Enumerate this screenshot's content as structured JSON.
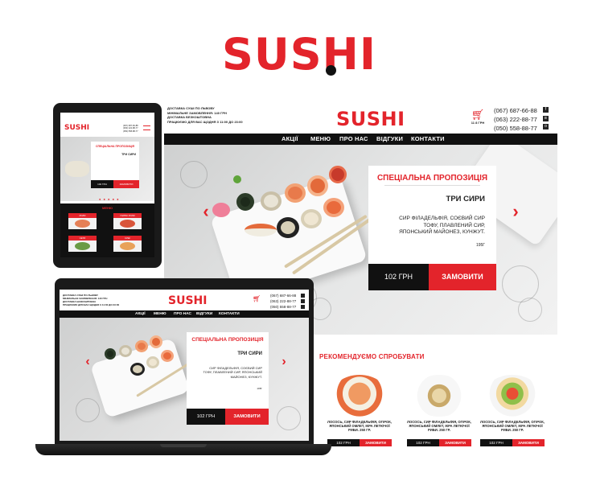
{
  "brand": {
    "logo": "SUSHI",
    "accent_color": "#e3242b",
    "dark_color": "#111111"
  },
  "header": {
    "info_lines": [
      "ДОСТАВКА СУШІ ПО ЛЬВОВУ",
      "МІНІМАЛЬНЕ ЗАМОВЛЕННЯ: 140 ГРН",
      "ДОСТАВКА БЕЗКОШТОВНА",
      "ПРАЦЮЄМО ДЛЯ ВАС ЩОДНЯ З 11:00 ДО 23:00"
    ],
    "cart_sum": "11 8 ГРН",
    "cart_icon": "cart-icon",
    "phones": [
      "(067) 687-66-88",
      "(063) 222-88-77",
      "(050) 558-88-77"
    ],
    "social": [
      {
        "icon": "facebook-icon",
        "glyph": "f"
      },
      {
        "icon": "vk-icon",
        "glyph": "в"
      },
      {
        "icon": "odnoklassniki-icon",
        "glyph": "о"
      }
    ]
  },
  "nav": {
    "items": [
      "АКЦІЇ",
      "МЕНЮ",
      "ПРО НАС",
      "ВІДГУКИ",
      "КОНТАКТИ"
    ]
  },
  "hero": {
    "special_title": "СПЕЦІАЛЬНА ПРОПОЗИЦІЯ",
    "product_name": "ТРИ СИРИ",
    "description": "СИР ФІЛАДЕЛЬФІЯ, СОЄВИЙ СИР ТОФУ, ПЛАВЛЕНИЙ СИР, ЯПОНСЬКИЙ МАЙОНЕЗ, КУНЖУТ.",
    "weight": "195Г",
    "price": "102 ГРН",
    "order_label": "ЗАМОВИТИ",
    "arrow_left": "‹",
    "arrow_right": "›"
  },
  "recommended": {
    "title": "РЕКОМЕНДУЄМО СПРОБУВАТИ",
    "products": [
      {
        "description": "ЛОСОСЬ, СИР ФІЛАДЕЛЬФІЯ, ОГІРОК, ЯПОНСЬКИЙ ОМЛЕТ, ІКРА ЛЕТЮЧОЇ РИБИ. 250 ГР.",
        "price": "102 ГРН",
        "order_label": "ЗАМОВИТИ"
      },
      {
        "description": "ЛОСОСЬ, СИР ФІЛАДЕЛЬФІЯ, ОГІРОК, ЯПОНСЬКИЙ ОМЛЕТ, ІКРА ЛЕТЮЧОЇ РИБИ. 250 ГР.",
        "price": "102 ГРН",
        "order_label": "ЗАМОВИТИ"
      },
      {
        "description": "ЛОСОСЬ, СИР ФІЛАДЕЛЬФІЯ, ОГІРОК, ЯПОНСЬКИЙ ОМЛЕТ, ІКРА ЛЕТЮЧОЇ РИБИ. 250 ГР.",
        "price": "102 ГРН",
        "order_label": "ЗАМОВИТИ"
      }
    ]
  },
  "tablet": {
    "menu_title": "МЕНЮ",
    "tiles": [
      "РОЛИ",
      "ГАРЯЧІ РОЛИ",
      "СЕТИ",
      "СУШІ"
    ],
    "dots": "● ● ● ● ●"
  }
}
